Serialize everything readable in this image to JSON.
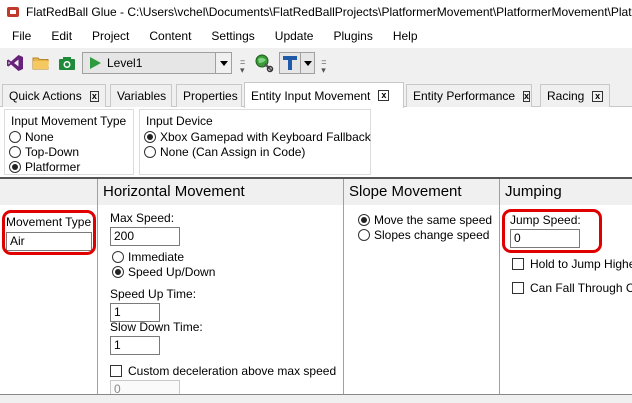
{
  "window": {
    "title": "FlatRedBall Glue - C:\\Users\\vchel\\Documents\\FlatRedBallProjects\\PlatformerMovement\\PlatformerMovement\\Plat"
  },
  "menu": [
    "File",
    "Edit",
    "Project",
    "Content",
    "Settings",
    "Update",
    "Plugins",
    "Help"
  ],
  "toolbar": {
    "screen_name": "Level1",
    "icons": [
      "visual-studio-icon",
      "folder-icon",
      "camera-icon",
      "play-icon",
      "wrench-globe-icon",
      "tool-t-icon"
    ]
  },
  "tabs": [
    {
      "label": "Quick Actions",
      "close": "x"
    },
    {
      "label": "Variables"
    },
    {
      "label": "Properties"
    },
    {
      "label": "Entity Input Movement",
      "close": "x",
      "active": true
    },
    {
      "label": "Entity Performance",
      "close": "x"
    },
    {
      "label": "Racing",
      "close": "x"
    }
  ],
  "input_movement_type": {
    "title": "Input Movement Type",
    "options": [
      "None",
      "Top-Down",
      "Platformer"
    ],
    "selected": "Platformer"
  },
  "input_device": {
    "title": "Input Device",
    "options": [
      "Xbox Gamepad with Keyboard Fallback",
      "None (Can Assign in Code)"
    ],
    "selected": "Xbox Gamepad with Keyboard Fallback"
  },
  "movement_type": {
    "label": "Movement Type",
    "value": "Air"
  },
  "horizontal": {
    "header": "Horizontal Movement",
    "max_speed_label": "Max Speed:",
    "max_speed_value": "200",
    "mode_options": [
      "Immediate",
      "Speed Up/Down"
    ],
    "mode_selected": "Speed Up/Down",
    "speed_up_label": "Speed Up Time:",
    "speed_up_value": "1",
    "slow_down_label": "Slow Down Time:",
    "slow_down_value": "1",
    "custom_decel_label": "Custom deceleration above max speed",
    "custom_decel_value": "0"
  },
  "slope": {
    "header": "Slope Movement",
    "options": [
      "Move the same speed",
      "Slopes change speed"
    ],
    "selected": "Move the same speed"
  },
  "jumping": {
    "header": "Jumping",
    "jump_speed_label": "Jump Speed:",
    "jump_speed_value": "0",
    "hold_label": "Hold to Jump Higher",
    "fall_through_label": "Can Fall Through Cloud"
  },
  "annotation_color": "#e00000"
}
